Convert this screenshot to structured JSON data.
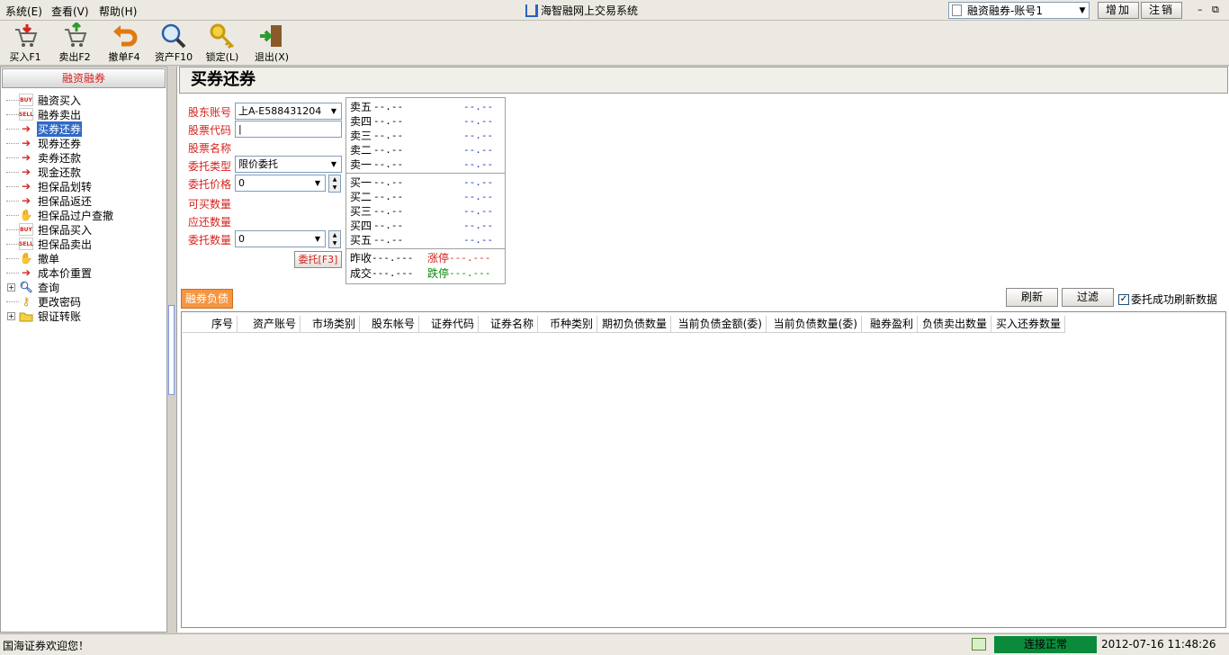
{
  "menu": {
    "items": [
      "系统(E)",
      "查看(V)",
      "帮助(H)"
    ]
  },
  "app_title": "海智融网上交易系统",
  "account_select": "融资融券-账号1",
  "buttons": {
    "add": "增加",
    "logout": "注销"
  },
  "window_controls": {
    "minimize": "–",
    "restore": "⧉"
  },
  "toolbar": [
    {
      "label": "买入F1",
      "icon": "cart-buy-icon"
    },
    {
      "label": "卖出F2",
      "icon": "cart-sell-icon"
    },
    {
      "label": "撤单F4",
      "icon": "undo-icon"
    },
    {
      "label": "资产F10",
      "icon": "magnifier-icon"
    },
    {
      "label": "锁定(L)",
      "icon": "key-icon"
    },
    {
      "label": "退出(X)",
      "icon": "exit-door-icon"
    }
  ],
  "left_header": "融资融券",
  "tree": [
    {
      "label": "融资买入",
      "icon": "BUY"
    },
    {
      "label": "融券卖出",
      "icon": "SELL"
    },
    {
      "label": "买券还券",
      "icon": "arrow",
      "selected": true
    },
    {
      "label": "现券还券",
      "icon": "arrow"
    },
    {
      "label": "卖券还款",
      "icon": "arrow"
    },
    {
      "label": "现金还款",
      "icon": "arrow"
    },
    {
      "label": "担保品划转",
      "icon": "arrow"
    },
    {
      "label": "担保品返还",
      "icon": "arrow"
    },
    {
      "label": "担保品过户查撤",
      "icon": "hand"
    },
    {
      "label": "担保品买入",
      "icon": "BUY"
    },
    {
      "label": "担保品卖出",
      "icon": "SELL"
    },
    {
      "label": "撤单",
      "icon": "hand"
    },
    {
      "label": "成本价重置",
      "icon": "arrow"
    },
    {
      "label": "查询",
      "icon": "magnifier",
      "expander": "+"
    },
    {
      "label": "更改密码",
      "icon": "key"
    },
    {
      "label": "银证转账",
      "icon": "folder",
      "expander": "+"
    }
  ],
  "page_title": "买券还券",
  "form": {
    "labels": {
      "account": "股东账号",
      "code": "股票代码",
      "name": "股票名称",
      "type": "委托类型",
      "price": "委托价格",
      "can_buy": "可买数量",
      "should_return": "应还数量",
      "qty": "委托数量"
    },
    "account_value": "上A-E588431204",
    "code_value": "|",
    "type_value": "限价委托",
    "price_value": "0",
    "qty_value": "0",
    "submit": "委托[F3]"
  },
  "quote": {
    "sell": [
      {
        "name": "卖五",
        "price": "--.--",
        "vol": "--.--"
      },
      {
        "name": "卖四",
        "price": "--.--",
        "vol": "--.--"
      },
      {
        "name": "卖三",
        "price": "--.--",
        "vol": "--.--"
      },
      {
        "name": "卖二",
        "price": "--.--",
        "vol": "--.--"
      },
      {
        "name": "卖一",
        "price": "--.--",
        "vol": "--.--"
      }
    ],
    "buy": [
      {
        "name": "买一",
        "price": "--.--",
        "vol": "--.--"
      },
      {
        "name": "买二",
        "price": "--.--",
        "vol": "--.--"
      },
      {
        "name": "买三",
        "price": "--.--",
        "vol": "--.--"
      },
      {
        "name": "买四",
        "price": "--.--",
        "vol": "--.--"
      },
      {
        "name": "买五",
        "price": "--.--",
        "vol": "--.--"
      }
    ],
    "prev_close_label": "昨收",
    "prev_close": "---.---",
    "limit_up_label": "涨停",
    "limit_up": "---.---",
    "deal_label": "成交",
    "deal": "---.---",
    "limit_down_label": "跌停",
    "limit_down": "---.---",
    "colors": {
      "limit_up": "#d4231e",
      "limit_down": "#0a8a0a",
      "vol": "#1a30c0"
    }
  },
  "tab_label": "融券负债",
  "actions": {
    "refresh": "刷新",
    "filter": "过滤",
    "auto_refresh": "委托成功刷新数据"
  },
  "grid_columns": [
    "序号",
    "资产账号",
    "市场类别",
    "股东帐号",
    "证券代码",
    "证券名称",
    "币种类别",
    "期初负债数量",
    "当前负债金额(委)",
    "当前负债数量(委)",
    "融券盈利",
    "负债卖出数量",
    "买入还券数量"
  ],
  "status": {
    "welcome": "国海证券欢迎您！",
    "connection": "连接正常",
    "datetime": "2012-07-16 11:48:26"
  }
}
